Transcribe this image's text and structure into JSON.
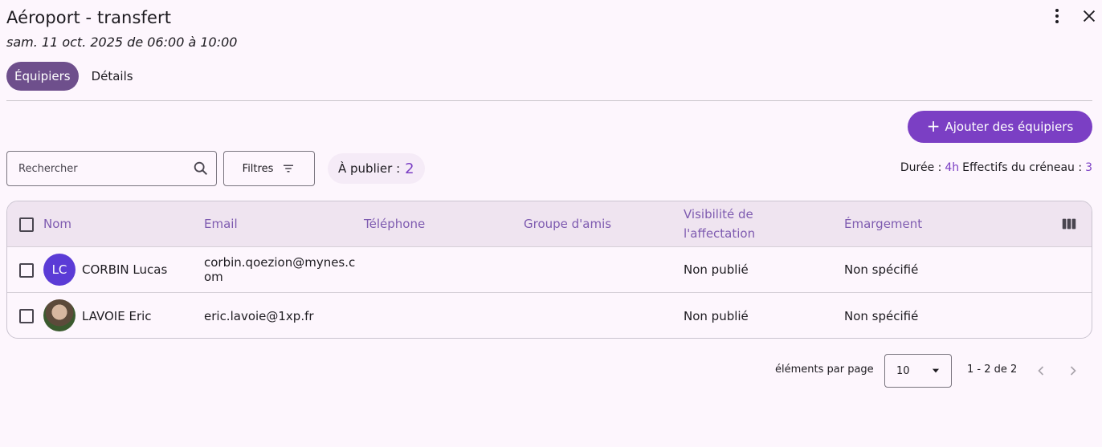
{
  "header": {
    "title": "Aéroport - transfert",
    "subtitle": "sam. 11 oct. 2025 de 06:00 à 10:00"
  },
  "tabs": [
    {
      "label": "Équipiers",
      "active": true
    },
    {
      "label": "Détails",
      "active": false
    }
  ],
  "toolbar": {
    "add_label": "Ajouter des équipiers",
    "search_placeholder": "Rechercher",
    "filters_label": "Filtres",
    "publish_label": "À publier :",
    "publish_count": "2",
    "duration_label": "Durée :",
    "duration_value": "4h",
    "staff_label": "Effectifs du créneau :",
    "staff_value": "3"
  },
  "table": {
    "columns": [
      "Nom",
      "Email",
      "Téléphone",
      "Groupe d'amis",
      "Visibilité de l'affectation",
      "Émargement"
    ],
    "rows": [
      {
        "initials": "LC",
        "name": "CORBIN Lucas",
        "email": "corbin.qoezion@mynes.com",
        "phone": "",
        "friends": "",
        "visibility": "Non publié",
        "attendance": "Non spécifié"
      },
      {
        "initials": "",
        "name": "LAVOIE Eric",
        "email": "eric.lavoie@1xp.fr",
        "phone": "",
        "friends": "",
        "visibility": "Non publié",
        "attendance": "Non spécifié"
      }
    ]
  },
  "pagination": {
    "per_page_label": "éléments par page",
    "per_page_value": "10",
    "range": "1 - 2 de 2"
  },
  "colors": {
    "accent": "#7b3fc4",
    "tab_active": "#6e4f8c",
    "header_bg": "#efe4f0",
    "column_text": "#7e5bb0",
    "avatar_bg": "#5b3bd6"
  }
}
